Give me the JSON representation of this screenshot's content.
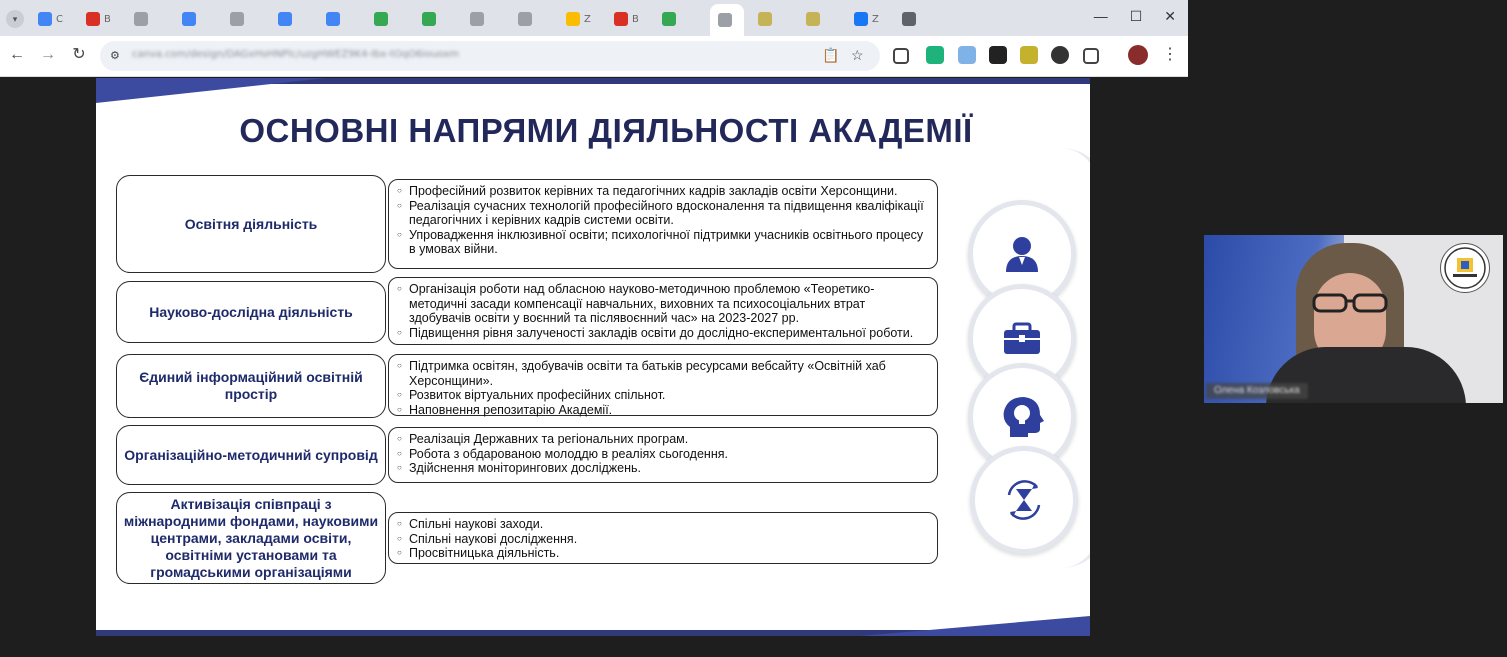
{
  "browser": {
    "tabs": [
      {
        "label": "C",
        "color": "#4285f4"
      },
      {
        "label": "B",
        "color": "#d93025"
      },
      {
        "label": "",
        "color": "#9aa0a6"
      },
      {
        "label": "",
        "color": "#4285f4"
      },
      {
        "label": "",
        "color": "#9aa0a6"
      },
      {
        "label": "",
        "color": "#4285f4"
      },
      {
        "label": "",
        "color": "#4285f4"
      },
      {
        "label": "",
        "color": "#34a853"
      },
      {
        "label": "",
        "color": "#34a853"
      },
      {
        "label": "",
        "color": "#9aa0a6"
      },
      {
        "label": "",
        "color": "#9aa0a6"
      },
      {
        "label": "Z",
        "color": "#fbbc04"
      },
      {
        "label": "B",
        "color": "#d93025"
      },
      {
        "label": "",
        "color": "#34a853"
      },
      {
        "label": "",
        "color": "#9aa0a6"
      },
      {
        "label": "",
        "color": "#c5b358"
      },
      {
        "label": "",
        "color": "#c5b358"
      },
      {
        "label": "Z",
        "color": "#1877f2"
      },
      {
        "label": "",
        "color": "#5f6368"
      }
    ],
    "url": "canva.com/design/DAGxHsHNPlc/uzgHWEZ9K4-Ibx-tOqO6iouoxm"
  },
  "slide": {
    "title": "ОСНОВНІ НАПРЯМИ ДІЯЛЬНОСТІ АКАДЕМІЇ",
    "rows": [
      {
        "label": "Освітня діяльність",
        "items": [
          "Професійний розвиток керівних та педагогічних кадрів закладів освіти Херсонщини.",
          "Реалізація сучасних технологій професійного вдосконалення та підвищення кваліфікації педагогічних і керівних кадрів системи освіти.",
          "Упровадження  інклюзивної освіти; психологічної підтримки учасників освітнього процесу в умовах війни."
        ]
      },
      {
        "label": "Науково-дослідна діяльність",
        "items": [
          "Організація роботи над обласною науково-методичною проблемою «Теоретико-методичні засади компенсації навчальних, виховних та психосоціальних втрат здобувачів освіти у воєнний та післявоєнний час» на 2023-2027 рр.",
          "Підвищення рівня залученості закладів освіти до дослідно-експериментальної роботи."
        ]
      },
      {
        "label": "Єдиний інформаційний освітній простір",
        "items": [
          "Підтримка освітян, здобувачів освіти та батьків  ресурсами вебсайту «Освітній хаб Херсонщини».",
          "Розвиток віртуальних професійних спільнот.",
          "Наповнення репозитарію Академії."
        ]
      },
      {
        "label": "Організаційно-методичний супровід",
        "items": [
          "Реалізація Державних та регіональних програм.",
          "Робота з обдарованою молоддю в реаліях сьогодення.",
          "Здійснення моніторингових досліджень."
        ]
      },
      {
        "label": "Активізація співпраці з міжнародними фондами, науковими центрами, закладами освіти, освітніми установами та громадськими організаціями",
        "items": [
          "Спільні наукові заходи.",
          "Спільні наукові дослідження.",
          "Просвітницька діяльність."
        ]
      }
    ],
    "icons": [
      "person-icon",
      "briefcase-icon",
      "lightbulb-head-icon",
      "hourglass-cycle-icon"
    ],
    "accent_color": "#2f3f9e"
  },
  "webcam": {
    "participant_name": "Олена Козловська"
  }
}
